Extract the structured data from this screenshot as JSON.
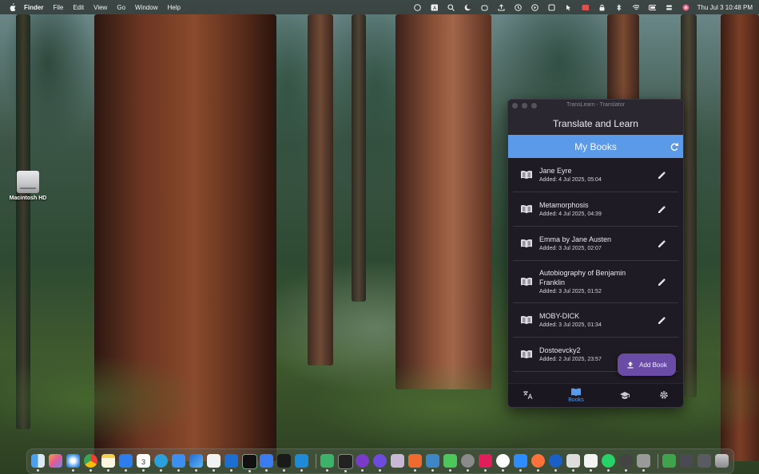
{
  "menubar": {
    "app": "Finder",
    "items": [
      "File",
      "Edit",
      "View",
      "Go",
      "Window",
      "Help"
    ],
    "clock": "Thu Jul 3  10:48 PM"
  },
  "desktop": {
    "drive_label": "Macintosh HD"
  },
  "window": {
    "title": "TransLearn - Translator",
    "header": "Translate and Learn",
    "tab": "My Books",
    "accent": "#5b9ae8",
    "books": [
      {
        "title": "Jane Eyre",
        "added": "Added: 4 Jul 2025, 05:04"
      },
      {
        "title": "Metamorphosis",
        "added": "Added: 4 Jul 2025, 04:39"
      },
      {
        "title": "Emma by Jane Austen",
        "added": "Added: 3 Jul 2025, 02:07"
      },
      {
        "title": "Autobiography of Benjamin Franklin",
        "added": "Added: 3 Jul 2025, 01:52"
      },
      {
        "title": "MOBY-DICK",
        "added": "Added: 3 Jul 2025, 01:34"
      },
      {
        "title": "Dostoevcky2",
        "added": "Added: 2 Jul 2025, 23:57"
      }
    ],
    "add_book": "Add Book",
    "nav": {
      "translate_icon": "translate-icon",
      "books_label": "Books",
      "learn_icon": "graduation-cap-icon",
      "settings_icon": "gear-icon"
    }
  },
  "dock": {
    "icons": [
      "finder-icon",
      "launchpad-icon",
      "safari-icon",
      "chrome-icon",
      "notes-icon",
      "app-store-icon",
      "calendar-icon",
      "telegram-icon",
      "mail-icon",
      "xcode-icon",
      "chatgpt-icon",
      "trello-icon",
      "pycharm-icon",
      "maps-icon",
      "cursor-icon",
      "vscode-icon",
      "android-studio-icon",
      "terminal-icon",
      "tor-icon",
      "proton-icon",
      "swift-icon",
      "simulator-icon",
      "messages-icon",
      "settings-icon",
      "slack-icon",
      "yandex-icon",
      "zoom-icon",
      "firefox-icon",
      "1password-icon",
      "preview-icon",
      "textedit-icon",
      "whatsapp-icon",
      "quicktime-icon",
      "finder-window-icon",
      "numbers-icon",
      "downloads-icon",
      "folder-icon",
      "trash-icon"
    ],
    "calendar_day": "3"
  }
}
